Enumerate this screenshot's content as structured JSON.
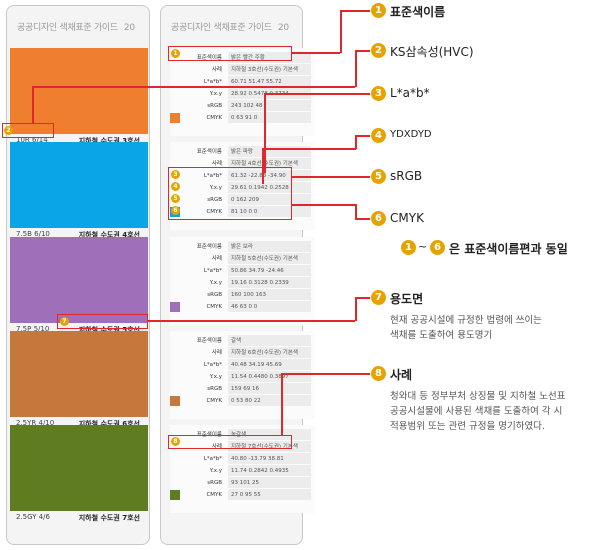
{
  "left_panel": {
    "title": "공공디자인 색채표준 가이드",
    "page": "20",
    "swatches": [
      {
        "color": "#ef7f2e",
        "code": "10R 6/14",
        "name": "지하철 수도권 3호선"
      },
      {
        "color": "#0aa5e5",
        "code": "7.5B 6/10",
        "name": "지하철 수도권 4호선"
      },
      {
        "color": "#9f70b9",
        "code": "7.5P 5/10",
        "name": "지하철 수도권 5호선"
      },
      {
        "color": "#c6773b",
        "code": "2.5YR 4/10",
        "name": "지하철 수도권 6호선"
      },
      {
        "color": "#5f7c21",
        "code": "2.5GY 4/6",
        "name": "지하철 수도권 7호선"
      }
    ]
  },
  "right_panel": {
    "title": "공공디자인 색채표준 가이드",
    "page": "20",
    "row_labels": [
      "표준색이름",
      "사례",
      "L*a*b*",
      "Y.x.y",
      "sRGB",
      "CMYK"
    ],
    "cards": [
      {
        "color": "#ef7f2e",
        "name": "밝은 빨간 주황",
        "example": "지하철 3호선(수도권) 기본색",
        "lab": "60.71  51.47  55.72",
        "yxy": "28.92  0.5478  0.3734",
        "srgb": "243  102  48",
        "cmyk": "0  63  91  0"
      },
      {
        "color": "#0aa5e5",
        "name": "밝은 파랑",
        "example": "지하철 4호선(수도권) 기본색",
        "lab": "61.32  -22.83  -34.90",
        "yxy": "29.61  0.1942  0.2528",
        "srgb": "0  162  209",
        "cmyk": "81  10  0  0"
      },
      {
        "color": "#9f70b9",
        "name": "밝은 보라",
        "example": "지하철 5호선(수도권) 기본색",
        "lab": "50.86  34.79  -24.46",
        "yxy": "19.16  0.3128  0.2339",
        "srgb": "160  100  163",
        "cmyk": "46  63  0  0"
      },
      {
        "color": "#c6773b",
        "name": "갈색",
        "example": "지하철 6호선(수도권) 기본색",
        "lab": "40.48  34.19  45.69",
        "yxy": "11.54  0.4480  0.3897",
        "srgb": "159  69  16",
        "cmyk": "0  53  80  22"
      },
      {
        "color": "#5f7c21",
        "name": "녹갈색",
        "example": "지하철 7호선(수도권) 기본색",
        "lab": "40.80  -13.79  38.81",
        "yxy": "11.74  0.2842  0.4935",
        "srgb": "93  101  25",
        "cmyk": "27  0  95  55"
      }
    ]
  },
  "legend": {
    "items": [
      {
        "num": "1",
        "label": "표준색이름"
      },
      {
        "num": "2",
        "label": "KS삼속성(HVC)"
      },
      {
        "num": "3",
        "label": "L*a*b*"
      },
      {
        "num": "4",
        "label": "YDXDYD"
      },
      {
        "num": "5",
        "label": "sRGB"
      },
      {
        "num": "6",
        "label": "CMYK"
      }
    ],
    "range_note": "은 표준색이름편과 동일",
    "range_from": "1",
    "range_sep": "~",
    "range_to": "6",
    "item7": {
      "num": "7",
      "label": "용도면",
      "desc1": "현재 공공시설에 규정한 법령에 쓰이는",
      "desc2": "색채를 도출하여 용도명기"
    },
    "item8": {
      "num": "8",
      "label": "사례",
      "desc1": "청와대 등 정부부처 상징물 및 지하철 노선표",
      "desc2": "공공시설물에 사용된 색채를 도출하여 각 시",
      "desc3": "적용범위 또는 관련 규정을 명기하였다."
    }
  },
  "colors": {
    "accent_red": "#e0282c",
    "badge_gold": "#e6a300"
  }
}
